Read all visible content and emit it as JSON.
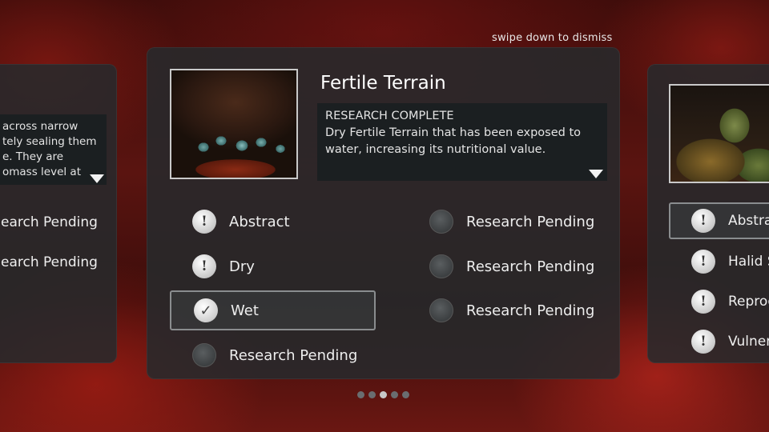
{
  "hint": "swipe down to dismiss",
  "main_card": {
    "title": "Fertile Terrain",
    "status": "RESEARCH COMPLETE",
    "description": "Dry Fertile Terrain that has been exposed to water, increasing its nutritional value.",
    "left_column": [
      {
        "label": "Abstract",
        "icon": "exclamation-icon"
      },
      {
        "label": "Dry",
        "icon": "exclamation-icon"
      },
      {
        "label": "Wet",
        "icon": "checkmark-icon",
        "selected": true
      },
      {
        "label": "Research Pending",
        "icon": "pending-icon"
      }
    ],
    "right_column": [
      {
        "label": "Research Pending",
        "icon": "pending-icon"
      },
      {
        "label": "Research Pending",
        "icon": "pending-icon"
      },
      {
        "label": "Research Pending",
        "icon": "pending-icon"
      }
    ]
  },
  "left_card": {
    "desc_lines": [
      "across narrow",
      "tely sealing them",
      "e.  They are",
      "omass level at"
    ],
    "items": [
      "earch Pending",
      "earch Pending"
    ]
  },
  "right_card": {
    "items": [
      "Abstrac",
      "Halid S",
      "Reprod",
      "Vulnera"
    ]
  },
  "pager": {
    "count": 5,
    "active": 2
  }
}
